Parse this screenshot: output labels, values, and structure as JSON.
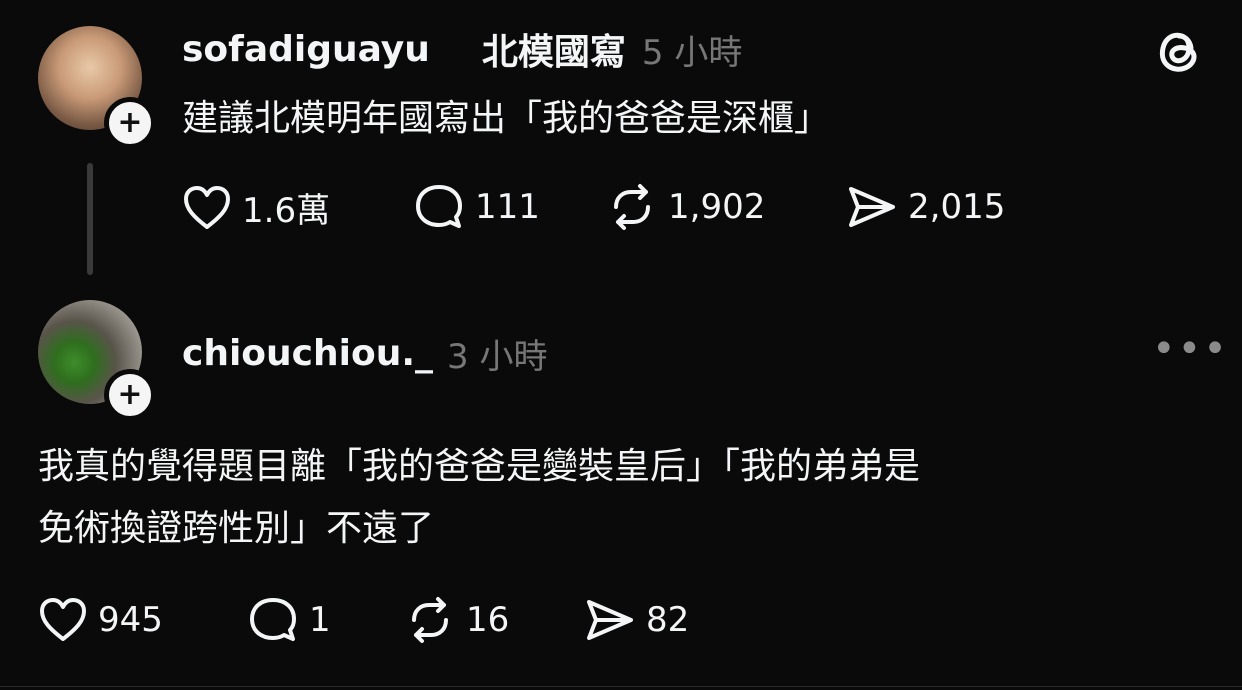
{
  "post1": {
    "username": "sofadiguayu",
    "community": "北模國寫",
    "time": "5 小時",
    "text": "建議北模明年國寫出「我的爸爸是深櫃」",
    "likes": "1.6萬",
    "comments": "111",
    "reposts": "1,902",
    "shares": "2,015"
  },
  "post2": {
    "username": "chiouchiou._",
    "time": "3 小時",
    "text_line1": "我真的覺得題目離「我的爸爸是變裝皇后」「我的弟弟是",
    "text_line2": "免術換證跨性別」不遠了",
    "likes": "945",
    "comments": "1",
    "reposts": "16",
    "shares": "82"
  },
  "icons": {
    "app": "threads-logo-icon",
    "like": "heart-icon",
    "comment": "comment-bubble-icon",
    "repost": "repost-icon",
    "share": "share-send-icon",
    "more": "more-options-icon",
    "follow": "plus-icon"
  },
  "colors": {
    "background": "#0a0a0a",
    "text": "#f3f5f7",
    "muted": "#777777"
  }
}
